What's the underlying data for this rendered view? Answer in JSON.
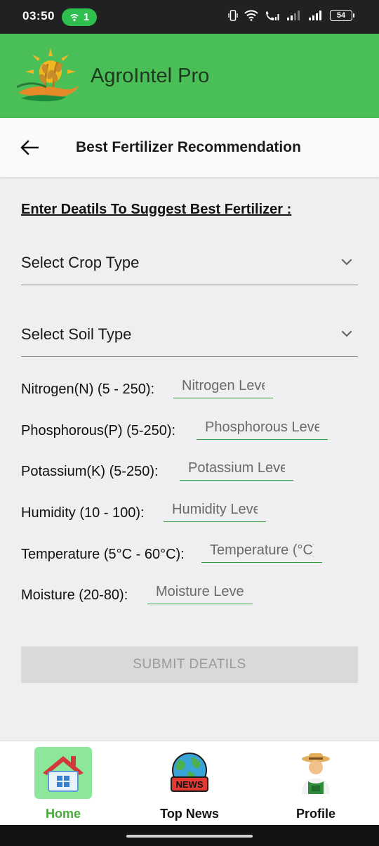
{
  "status_bar": {
    "time": "03:50",
    "hotspot_count": "1",
    "battery": "54"
  },
  "app_bar": {
    "title": "AgroIntel Pro"
  },
  "title_bar": {
    "title": "Best Fertilizer Recommendation"
  },
  "form": {
    "heading": "Enter Deatils To Suggest Best Fertilizer :",
    "crop_select": {
      "label": "Select Crop Type"
    },
    "soil_select": {
      "label": "Select Soil Type"
    },
    "fields": [
      {
        "label": "Nitrogen(N) (5 - 250):",
        "placeholder": "Nitrogen Level",
        "value": ""
      },
      {
        "label": "Phosphorous(P) (5-250):",
        "placeholder": "Phosphorous Level",
        "value": ""
      },
      {
        "label": "Potassium(K) (5-250):",
        "placeholder": "Potassium Level",
        "value": ""
      },
      {
        "label": "Humidity (10 - 100):",
        "placeholder": "Humidity Level",
        "value": ""
      },
      {
        "label": "Temperature (5°C - 60°C):",
        "placeholder": "Temperature (°C)",
        "value": ""
      },
      {
        "label": "Moisture (20-80):",
        "placeholder": "Moisture Level",
        "value": ""
      }
    ],
    "submit_label": "SUBMIT DEATILS"
  },
  "bottom_nav": {
    "items": [
      {
        "label": "Home",
        "icon": "house-icon",
        "active": true
      },
      {
        "label": "Top News",
        "icon": "news-globe-icon",
        "badge_text": "NEWS",
        "active": false
      },
      {
        "label": "Profile",
        "icon": "farmer-icon",
        "active": false
      }
    ]
  },
  "colors": {
    "app_bar": "#4bbf57",
    "active_nav_bg": "#8ce79a",
    "active_nav_text": "#4aa83d",
    "input_underline": "#2f9a3a",
    "submit_disabled_bg": "#d9d9da"
  }
}
